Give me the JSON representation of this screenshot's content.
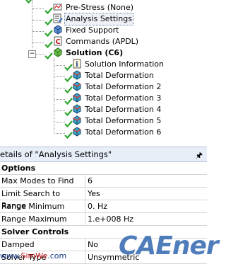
{
  "tree": {
    "items": [
      {
        "label": "Pre-Stress (None)",
        "icon": "pre-stress-icon",
        "checked": true
      },
      {
        "label": "Analysis Settings",
        "icon": "analysis-settings-icon",
        "checked": true,
        "selected": true
      },
      {
        "label": "Fixed Support",
        "icon": "fixed-support-icon",
        "checked": true
      },
      {
        "label": "Commands (APDL)",
        "icon": "commands-apdl-icon",
        "checked": true
      },
      {
        "label": "Solution (C6)",
        "icon": "solution-icon",
        "checked": true,
        "bold": true,
        "expander": "−"
      },
      {
        "label": "Solution Information",
        "icon": "solution-information-icon",
        "checked": true
      },
      {
        "label": "Total Deformation",
        "icon": "total-deformation-icon",
        "checked": true
      },
      {
        "label": "Total Deformation 2",
        "icon": "total-deformation-icon",
        "checked": true
      },
      {
        "label": "Total Deformation 3",
        "icon": "total-deformation-icon",
        "checked": true
      },
      {
        "label": "Total Deformation 4",
        "icon": "total-deformation-icon",
        "checked": true
      },
      {
        "label": "Total Deformation 5",
        "icon": "total-deformation-icon",
        "checked": true
      },
      {
        "label": "Total Deformation 6",
        "icon": "total-deformation-icon",
        "checked": true
      }
    ]
  },
  "details": {
    "title": "etails of \"Analysis Settings\"",
    "pin_icon": "pin-icon",
    "sections": [
      {
        "name": "Options",
        "rows": [
          {
            "key": "Max Modes to Find",
            "value": "6"
          },
          {
            "key": "Limit Search to Range",
            "value": "Yes"
          },
          {
            "key": "Range Minimum",
            "value": "0. Hz"
          },
          {
            "key": "Range Maximum",
            "value": "1.e+008 Hz"
          }
        ]
      },
      {
        "name": "Solver Controls",
        "rows": [
          {
            "key": "Damped",
            "value": "No"
          },
          {
            "key": "Solver Type",
            "value": "Unsymmetric"
          }
        ]
      }
    ]
  },
  "watermark": {
    "prefix": "www.",
    "red": "SimWe",
    "suffix": ".com",
    "logo": "CAEner"
  },
  "colors": {
    "check": "#2aa52a",
    "header_bg": "#e7eef8",
    "logo": "#3d6fb4",
    "watermark_red": "#c4161c"
  }
}
